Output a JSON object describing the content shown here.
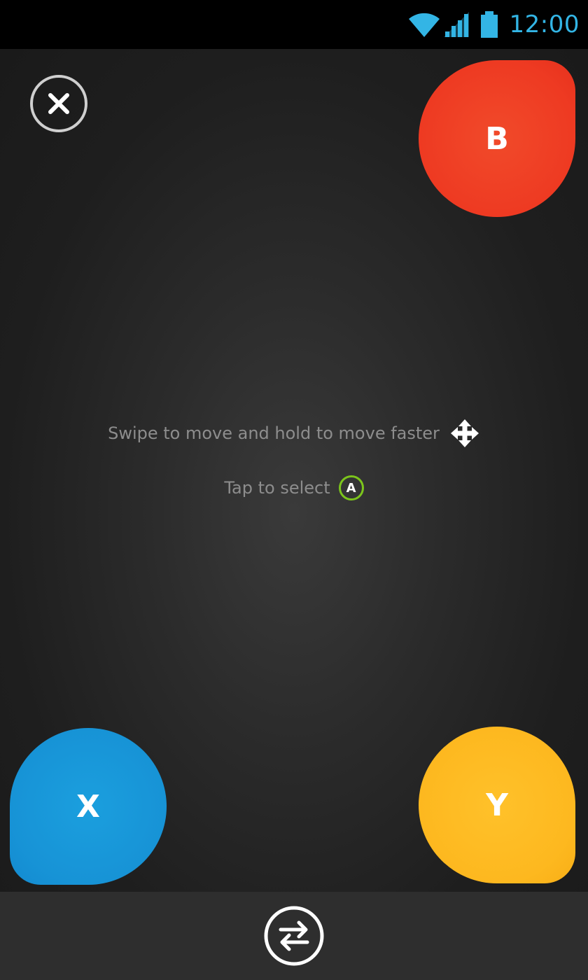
{
  "status_bar": {
    "time": "12:00",
    "icons": [
      "wifi-icon",
      "signal-icon",
      "battery-icon"
    ],
    "accent_color": "#33b5e5"
  },
  "controller": {
    "close_icon": "close-icon",
    "buttons": {
      "b": {
        "label": "B",
        "color": "#ee3a22"
      },
      "x": {
        "label": "X",
        "color": "#1793d6"
      },
      "y": {
        "label": "Y",
        "color": "#fdb81f"
      }
    },
    "hints": {
      "move_text": "Swipe to move and hold to move faster",
      "move_icon": "move-arrows-icon",
      "select_text": "Tap to select",
      "select_badge": "A",
      "select_badge_color": "#7cc51c"
    }
  },
  "bottom_bar": {
    "switch_icon": "switch-arrows-icon"
  }
}
